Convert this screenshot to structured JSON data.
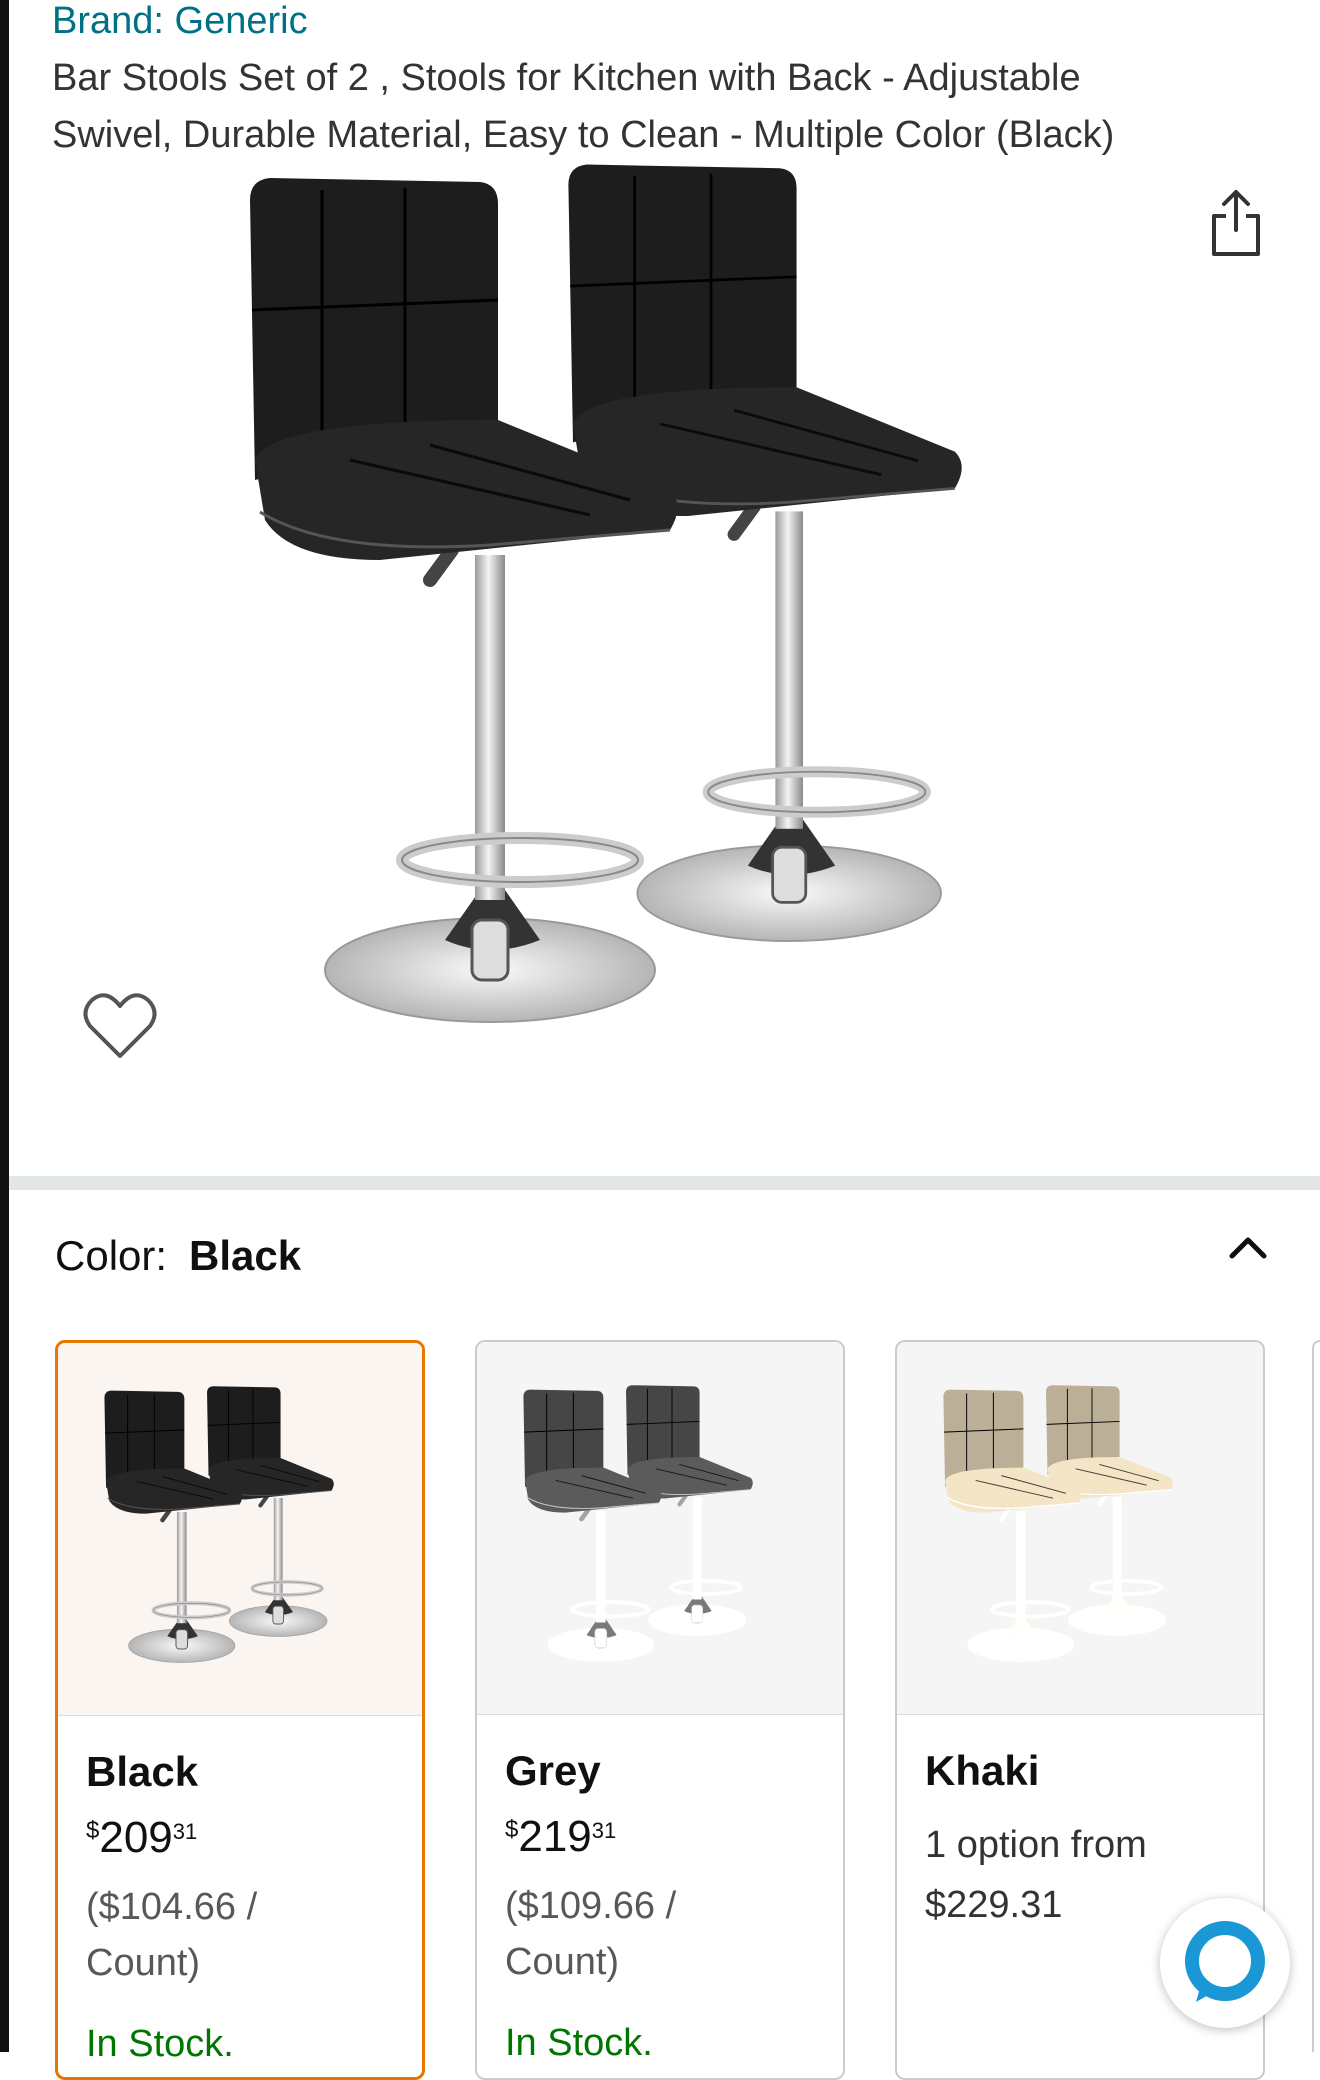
{
  "product": {
    "brand": "Brand: Generic",
    "title": "Bar Stools Set of 2 , Stools for Kitchen with Back - Adjustable Swivel, Durable Material, Easy to Clean - Multiple Color (Black)"
  },
  "color": {
    "label": "Color:",
    "selected": "Black"
  },
  "swatches": [
    {
      "name": "Black",
      "currency": "$",
      "whole": "209",
      "fraction": "31",
      "unit_line1": "($104.66 /",
      "unit_line2": "Count)",
      "stock": "In Stock.",
      "color_hex": "#1e1e1e"
    },
    {
      "name": "Grey",
      "currency": "$",
      "whole": "219",
      "fraction": "31",
      "unit_line1": "($109.66 /",
      "unit_line2": "Count)",
      "stock": "In Stock.",
      "color_hex": "#5a5a5a"
    },
    {
      "name": "Khaki",
      "options_line1": "1 option from",
      "options_line2": "$229.31",
      "color_hex": "#e8d8c4"
    }
  ],
  "colors": {
    "link": "#007185",
    "stock": "#007600",
    "selected_border": "#e77600",
    "alexa_blue": "#1a98d5"
  },
  "icons": {
    "share": "share-icon",
    "wishlist": "heart-icon",
    "collapse": "chevron-up-icon",
    "assistant": "alexa-icon"
  }
}
